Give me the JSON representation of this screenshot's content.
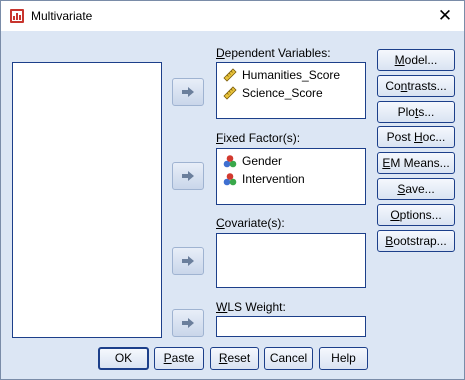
{
  "window": {
    "title": "Multivariate"
  },
  "groups": {
    "dependent": {
      "label_u": "D",
      "label_rest": "ependent Variables:",
      "items": [
        "Humanities_Score",
        "Science_Score"
      ]
    },
    "fixed": {
      "label_u": "F",
      "label_rest": "ixed Factor(s):",
      "items": [
        "Gender",
        "Intervention"
      ]
    },
    "covariate": {
      "label_u": "C",
      "label_rest": "ovariate(s):"
    },
    "wls": {
      "label_u": "W",
      "label_rest": "LS Weight:"
    }
  },
  "side_buttons": {
    "model": {
      "u": "M",
      "rest": "odel..."
    },
    "contrasts": {
      "pre": "Co",
      "u": "n",
      "rest": "trasts..."
    },
    "plots": {
      "pre": "Plo",
      "u": "t",
      "rest": "s..."
    },
    "posthoc": {
      "pre": "Post ",
      "u": "H",
      "rest": "oc..."
    },
    "emmeans": {
      "pre": "",
      "u": "E",
      "rest": "M Means..."
    },
    "save": {
      "u": "S",
      "rest": "ave..."
    },
    "options": {
      "u": "O",
      "rest": "ptions..."
    },
    "bootstrap": {
      "u": "B",
      "rest": "ootstrap..."
    }
  },
  "bottom_buttons": {
    "ok": "OK",
    "paste": {
      "u": "P",
      "rest": "aste"
    },
    "reset": {
      "u": "R",
      "rest": "eset"
    },
    "cancel": "Cancel",
    "help": "Help"
  },
  "colors": {
    "accent": "#1c3f8a",
    "background": "#dce6f4"
  },
  "icons": {
    "variable": "ruler-icon",
    "factor": "nominal-factor-icon",
    "arrow": "move-right-arrow-icon"
  }
}
